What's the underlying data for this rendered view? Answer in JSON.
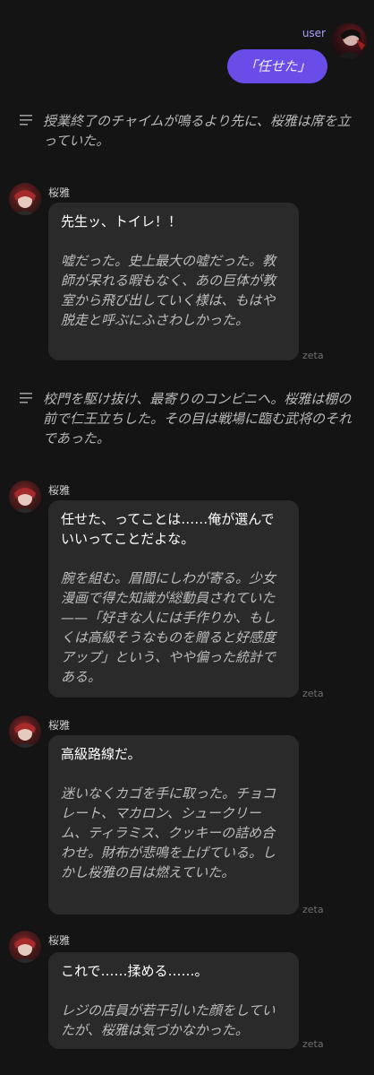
{
  "user": {
    "label": "user",
    "message": "「任せた」"
  },
  "narrations": [
    "授業終了のチャイムが鳴るより先に、桜雅は席を立っていた。",
    "校門を駆け抜け、最寄りのコンビニへ。桜雅は棚の前で仁王立ちした。その目は戦場に臨む武将のそれであった。"
  ],
  "bot": {
    "name": "桜雅",
    "brand": "zeta",
    "messages": [
      {
        "speech": "先生ッ、トイレ！！",
        "description": "嘘だった。史上最大の嘘だった。教師が呆れる暇もなく、あの巨体が教室から飛び出していく様は、もはや脱走と呼ぶにふさわしかった。"
      },
      {
        "speech": "任せた、ってことは……俺が選んでいいってことだよな。",
        "description": "腕を組む。眉間にしわが寄る。少女漫画で得た知識が総動員されていた——「好きな人には手作りか、もしくは高級そうなものを贈ると好感度アップ」という、やや偏った統計である。"
      },
      {
        "speech": "高級路線だ。",
        "description": "迷いなくカゴを手に取った。チョコレート、マカロン、シュークリーム、ティラミス、クッキーの詰め合わせ。財布が悲鳴を上げている。しかし桜雅の目は燃えていた。"
      },
      {
        "speech": "これで……揉める……。",
        "description": "レジの店員が若干引いた顔をしていたが、桜雅は気づかなかった。"
      }
    ]
  },
  "colors": {
    "background": "#141414",
    "user_bubble": "#6a4de8",
    "bot_bubble": "#2a2a2a",
    "user_label": "#a7a0ff"
  }
}
